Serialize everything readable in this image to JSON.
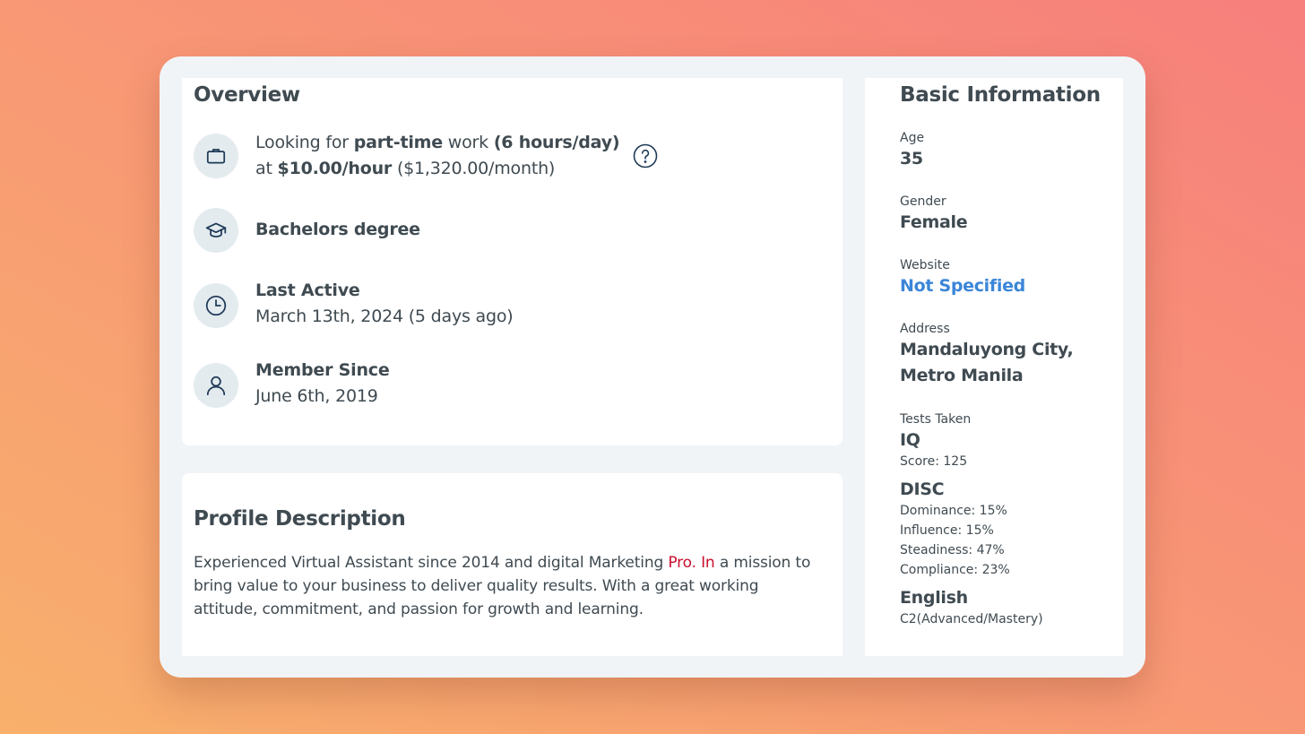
{
  "overview": {
    "title": "Overview",
    "work": {
      "l1_a": "Looking for",
      "l1_b": "part-time",
      "l1_c": "work",
      "l1_d": "(6 hours/day)",
      "l2_a": "at",
      "l2_b": "$10.00/hour",
      "l2_c": "($1,320.00/month)",
      "icon": "briefcase-icon",
      "help_icon": "question-circle-icon"
    },
    "education": {
      "label": "Bachelors degree",
      "icon": "graduation-cap-icon"
    },
    "last_active": {
      "label": "Last Active",
      "value": "March 13th, 2024 (5 days ago)",
      "icon": "clock-icon"
    },
    "member_since": {
      "label": "Member Since",
      "value": "June 6th, 2019",
      "icon": "user-icon"
    }
  },
  "profile": {
    "title": "Profile Description",
    "text_a": "Experienced Virtual Assistant since 2014 and digital Marketing ",
    "text_highlight": "Pro. In",
    "text_b": " a mission to bring value to your business to deliver quality results. With a great working attitude, commitment, and passion for growth and learning."
  },
  "basic": {
    "title": "Basic Information",
    "age_label": "Age",
    "age_value": "35",
    "gender_label": "Gender",
    "gender_value": "Female",
    "website_label": "Website",
    "website_value": "Not Specified",
    "address_label": "Address",
    "address_value": "Mandaluyong City, Metro Manila",
    "tests_label": "Tests Taken",
    "iq": {
      "name": "IQ",
      "score": "Score:  125"
    },
    "disc": {
      "name": "DISC",
      "dominance": "Dominance: 15%",
      "influence": "Influence: 15%",
      "steadiness": "Steadiness: 47%",
      "compliance": "Compliance: 23%"
    },
    "english": {
      "name": "English",
      "level": "C2(Advanced/Mastery)"
    }
  },
  "colors": {
    "text": "#3f4a51",
    "link": "#3b86d8",
    "highlight": "#c8102e",
    "icon_stroke": "#1f3a57",
    "icon_bg": "#e3ebef",
    "card_frame": "#f1f4f7"
  }
}
